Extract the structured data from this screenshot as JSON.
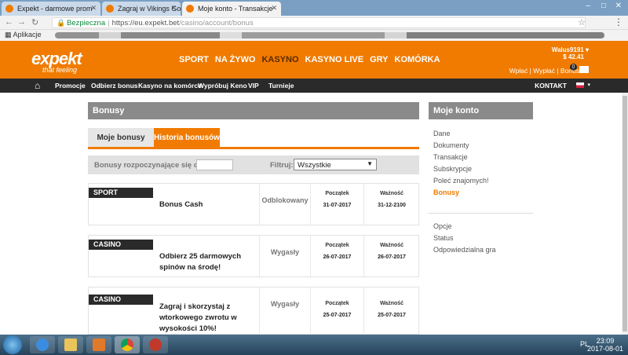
{
  "browser": {
    "tabs": [
      {
        "label": "Expekt - darmowe prom",
        "active": false
      },
      {
        "label": "Zagraj w Vikings Go",
        "active": false
      },
      {
        "label": "Moje konto - Transakcje",
        "active": true
      }
    ],
    "secure_label": "Bezpieczna",
    "url_host": "https://eu.expekt.bet",
    "url_path": "/casino/account/bonus",
    "bookmarks_label": "Aplikacje"
  },
  "header": {
    "logo": "expekt",
    "tagline": "that feeling",
    "nav": [
      "SPORT",
      "NA ŻYWO",
      "KASYNO",
      "KASYNO LIVE",
      "GRY",
      "KOMÓRKA"
    ],
    "nav_current": "KASYNO",
    "username": "Walus9191",
    "balance": "$ 42.41",
    "account_links": "Wpłać | Wypłać | Bonus",
    "badge_count": "0"
  },
  "subnav": {
    "items": [
      "Promocje",
      "Odbierz bonus",
      "Kasyno na komórce",
      "Wypróbuj Keno",
      "VIP",
      "Turnieje"
    ],
    "kontakt": "KONTAKT"
  },
  "main": {
    "title": "Bonusy",
    "tabs": [
      "Moje bonusy",
      "Historia bonusów"
    ],
    "active_tab": "Historia bonusów",
    "filter": {
      "date_label": "Bonusy rozpoczynające się od:",
      "date_value": "",
      "filter_label": "Filtruj:",
      "filter_value": "Wszystkie"
    },
    "columns": {
      "start": "Początek",
      "end": "Ważność"
    },
    "bonuses": [
      {
        "category": "SPORT",
        "name": "Bonus Cash",
        "status": "Odblokowany",
        "start": "31-07-2017",
        "end": "31-12-2100"
      },
      {
        "category": "CASINO",
        "name": "Odbierz 25 darmowych spinów na środę!",
        "status": "Wygasły",
        "start": "26-07-2017",
        "end": "26-07-2017"
      },
      {
        "category": "CASINO",
        "name": "Zagraj i skorzystaj z wtorkowego zwrotu w wysokości 10%!",
        "status": "Wygasły",
        "start": "25-07-2017",
        "end": "25-07-2017"
      }
    ]
  },
  "sidebar": {
    "title": "Moje konto",
    "items": [
      "Dane",
      "Dokumenty",
      "Transakcje",
      "Subskrypcje",
      "Poleć znajomych!",
      "Bonusy"
    ],
    "active": "Bonusy",
    "items2": [
      "Opcje",
      "Status",
      "Odpowiedzialna gra"
    ]
  },
  "taskbar": {
    "time": "23:09",
    "date": "2017-08-01",
    "lang": "PL"
  },
  "colors": {
    "brand_orange": "#f07b00",
    "dark_bar": "#2a2a2a",
    "title_gray": "#8a8a8a"
  }
}
